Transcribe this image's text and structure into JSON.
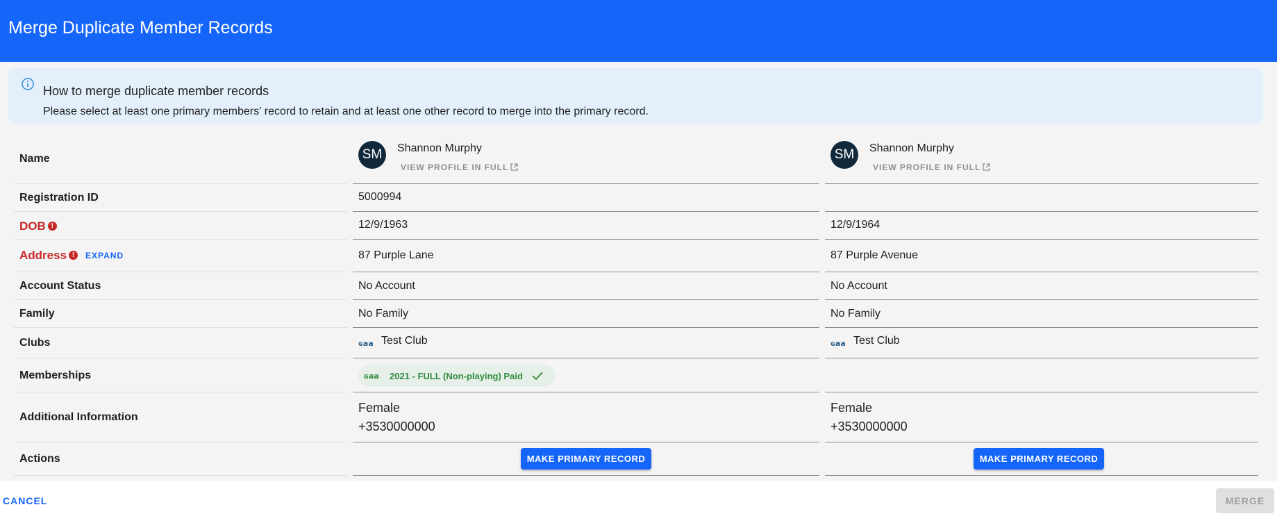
{
  "window": {
    "title": "Merge Duplicate Member Records"
  },
  "info": {
    "title": "How to merge duplicate member records",
    "text": "Please select at least one primary members' record to retain and at least one other record to merge into the primary record."
  },
  "labels": {
    "name": "Name",
    "registration_id": "Registration ID",
    "dob": "DOB",
    "address": "Address",
    "expand": "EXPAND",
    "account_status": "Account Status",
    "family": "Family",
    "clubs": "Clubs",
    "memberships": "Memberships",
    "additional_information": "Additional Information",
    "actions": "Actions"
  },
  "records": [
    {
      "initials": "SM",
      "name": "Shannon Murphy",
      "view_profile": "VIEW PROFILE IN FULL",
      "registration_id": "5000994",
      "dob": "12/9/1963",
      "address": "87 Purple Lane",
      "account_status": "No Account",
      "family": "No Family",
      "club": "Test Club",
      "membership": "2021 - FULL (Non-playing) Paid",
      "gender": "Female",
      "phone": "+3530000000",
      "action": "MAKE PRIMARY RECORD"
    },
    {
      "initials": "SM",
      "name": "Shannon Murphy",
      "view_profile": "VIEW PROFILE IN FULL",
      "registration_id": "",
      "dob": "12/9/1964",
      "address": "87 Purple Avenue",
      "account_status": "No Account",
      "family": "No Family",
      "club": "Test Club",
      "membership": "",
      "gender": "Female",
      "phone": "+3530000000",
      "action": "MAKE PRIMARY RECORD"
    }
  ],
  "footer": {
    "cancel": "CANCEL",
    "merge": "MERGE"
  },
  "colors": {
    "header": "#1565f9",
    "error": "#c62828",
    "membership_green": "#2e8b3e"
  }
}
